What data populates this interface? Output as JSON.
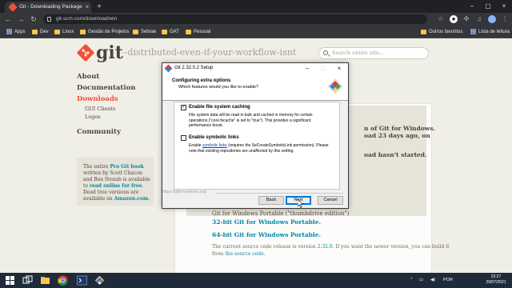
{
  "browser": {
    "tab_title": "Git - Downloading Package",
    "tab_close": "×",
    "new_tab": "+",
    "url": "git-scm.com/download/win",
    "window_controls": {
      "minimize": "–",
      "maximize": "▢",
      "close": "×"
    },
    "nav": {
      "back": "←",
      "forward": "→",
      "reload": "↻"
    },
    "bookmarks": [
      {
        "label": "Apps",
        "icon": "apps-grid-icon"
      },
      {
        "label": "Dev",
        "icon": "folder-icon"
      },
      {
        "label": "Linux",
        "icon": "folder-icon"
      },
      {
        "label": "Gestão de Projetos",
        "icon": "folder-icon"
      },
      {
        "label": "Sebrae",
        "icon": "folder-icon"
      },
      {
        "label": "GAT",
        "icon": "folder-icon"
      },
      {
        "label": "Pessoal",
        "icon": "folder-icon"
      }
    ],
    "bookmarks_right": [
      {
        "label": "Outros favoritos",
        "icon": "folder-icon"
      },
      {
        "label": "Lista de leitura",
        "icon": "reading-list-icon"
      }
    ]
  },
  "site": {
    "logo_text": "git",
    "tagline": "--distributed-even-if-your-workflow-isnt",
    "search_placeholder": "Search entire site...",
    "nav": {
      "about": "About",
      "documentation": "Documentation",
      "downloads": "Downloads",
      "gui_clients": "GUI Clients",
      "logos": "Logos",
      "community": "Community"
    },
    "book": {
      "t1": "The entire ",
      "l1": "Pro Git book",
      "t2": " written by Scott Chacon and Ben Straub is available to ",
      "l2": "read online for free",
      "t3": ". Dead tree versions are available on ",
      "l3": "Amazon.com",
      "t4": "."
    },
    "content": {
      "frag1": "n of Git for Windows.",
      "frag2": "oad 23 days ago, on",
      "frag3": "oad hasn't started.",
      "portable_title": "Git for Windows Portable (\"thumbdrive edition\")",
      "portable_32": "32-bit Git for Windows Portable.",
      "portable_64": "64-bit Git for Windows Portable.",
      "source_text1": "The current source code release is version ",
      "source_version": "2.32.0",
      "source_text2": ". If you want the newer version, you can build it",
      "source_text3": "from ",
      "source_link": "the source code",
      "source_text4": "."
    }
  },
  "dialog": {
    "title": "Git 2.32.0.2 Setup",
    "controls": {
      "minimize": "–",
      "maximize": "□",
      "close": "×"
    },
    "heading": "Configuring extra options",
    "subheading": "Which features would you like to enable?",
    "option1": {
      "label": "Enable file system caching",
      "checked": true,
      "check_mark": "✓",
      "description": "File system data will be read in bulk and cached in memory for certain operations (\"core.fscache\" is set to \"true\"). This provides a significant performance boost."
    },
    "option2": {
      "label": "Enable symbolic links",
      "checked": false,
      "desc_before": "Enable ",
      "desc_link": "symbolic links",
      "desc_after": " (requires the SeCreateSymbolicLink permission). Please note that existing repositories are unaffected by this setting."
    },
    "footer_link": "https://gitforwindows.org/",
    "buttons": {
      "back": "Back",
      "next": "Next",
      "cancel": "Cancel"
    }
  },
  "taskbar": {
    "language": "POR",
    "time": "22:27",
    "date": "29/07/2021"
  },
  "colors": {
    "git_orange": "#f05133",
    "link_blue": "#0388a6",
    "page_bg": "#f0efe7"
  }
}
